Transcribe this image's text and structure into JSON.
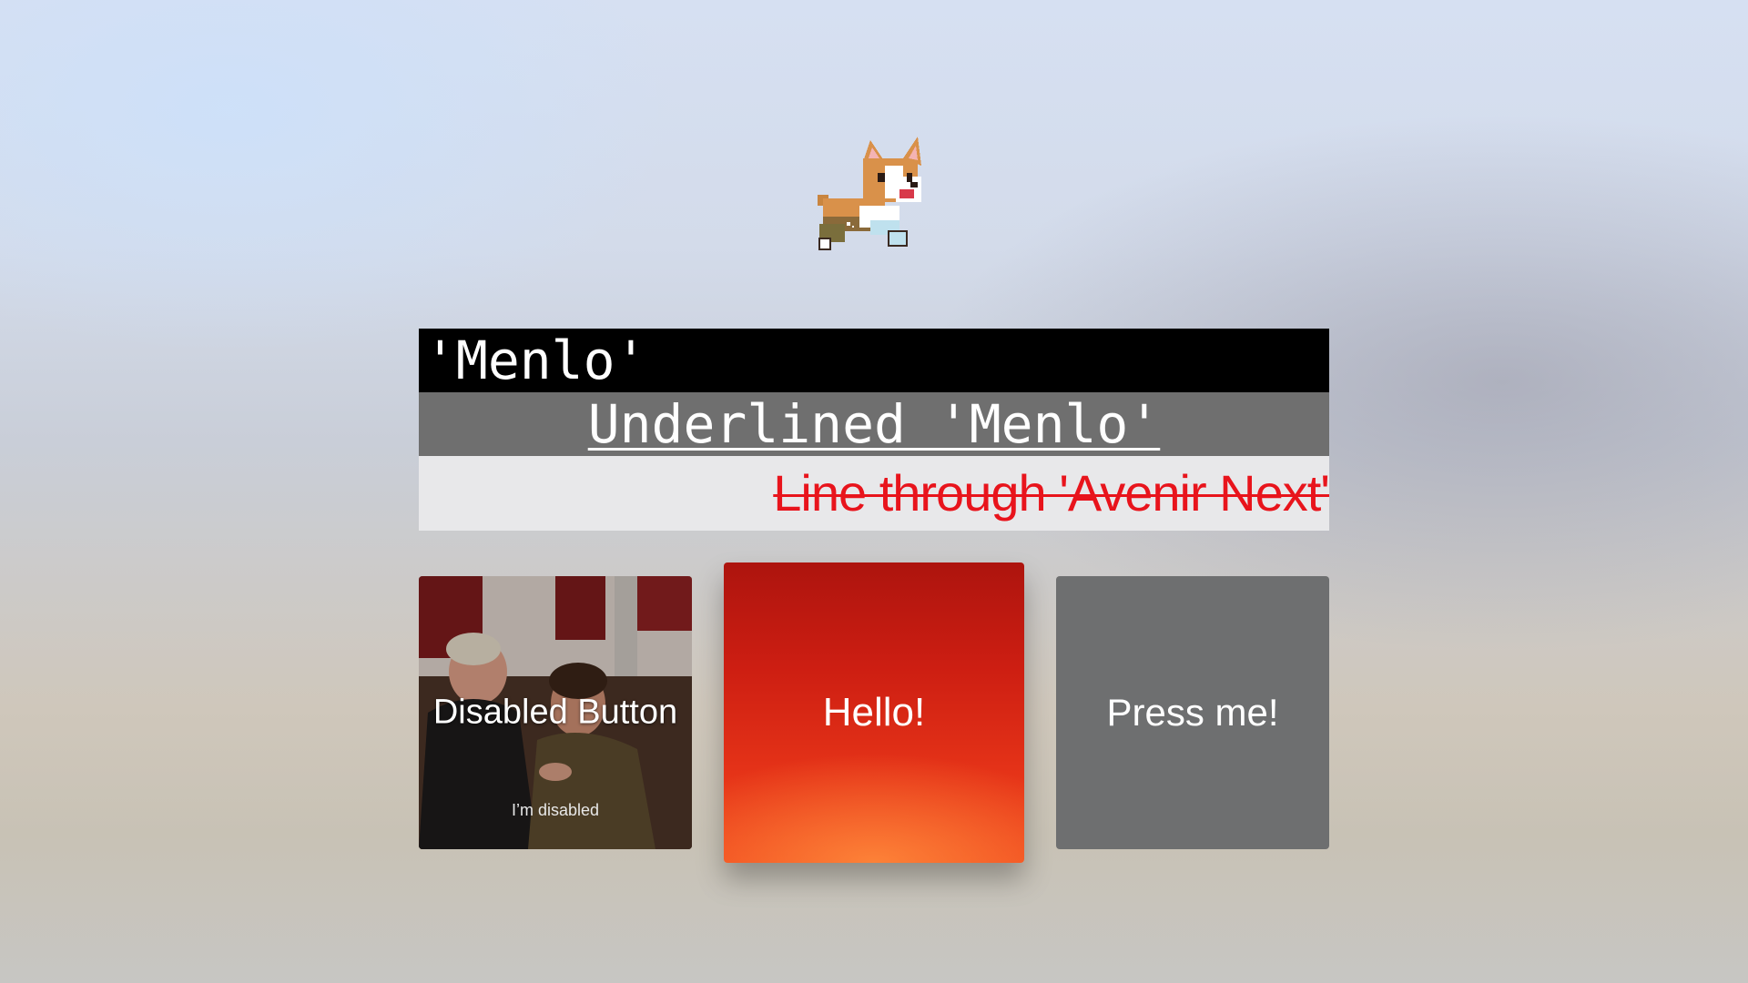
{
  "mascot": {
    "icon": "corgi-icon"
  },
  "rows": {
    "menlo": "'Menlo'",
    "underlined": "Underlined 'Menlo'",
    "strike": "Line through 'Avenir Next'"
  },
  "cards": {
    "disabled": {
      "label": "Disabled Button",
      "subtitle": "I’m disabled"
    },
    "focused": {
      "label": "Hello!"
    },
    "press": {
      "label": "Press me!"
    }
  },
  "colors": {
    "strike_text": "#e8141c",
    "focused_card": "#e53318",
    "press_card": "#6e6f70"
  }
}
